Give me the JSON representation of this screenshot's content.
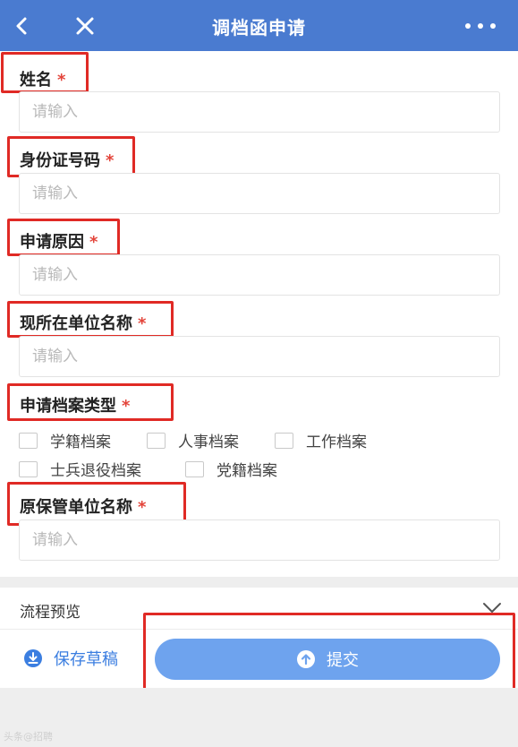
{
  "header": {
    "title": "调档函申请"
  },
  "fields": {
    "name": {
      "label": "姓名",
      "placeholder": "请输入"
    },
    "id_number": {
      "label": "身份证号码",
      "placeholder": "请输入"
    },
    "reason": {
      "label": "申请原因",
      "placeholder": "请输入"
    },
    "work_unit": {
      "label": "现所在单位名称",
      "placeholder": "请输入"
    },
    "archive_type": {
      "label": "申请档案类型",
      "options": [
        "学籍档案",
        "人事档案",
        "工作档案",
        "士兵退役档案",
        "党籍档案"
      ]
    },
    "original_unit": {
      "label": "原保管单位名称",
      "placeholder": "请输入"
    }
  },
  "required_mark": "*",
  "flow_preview": "流程预览",
  "actions": {
    "save": "保存草稿",
    "submit": "提交"
  },
  "watermark": "头条@招聘"
}
